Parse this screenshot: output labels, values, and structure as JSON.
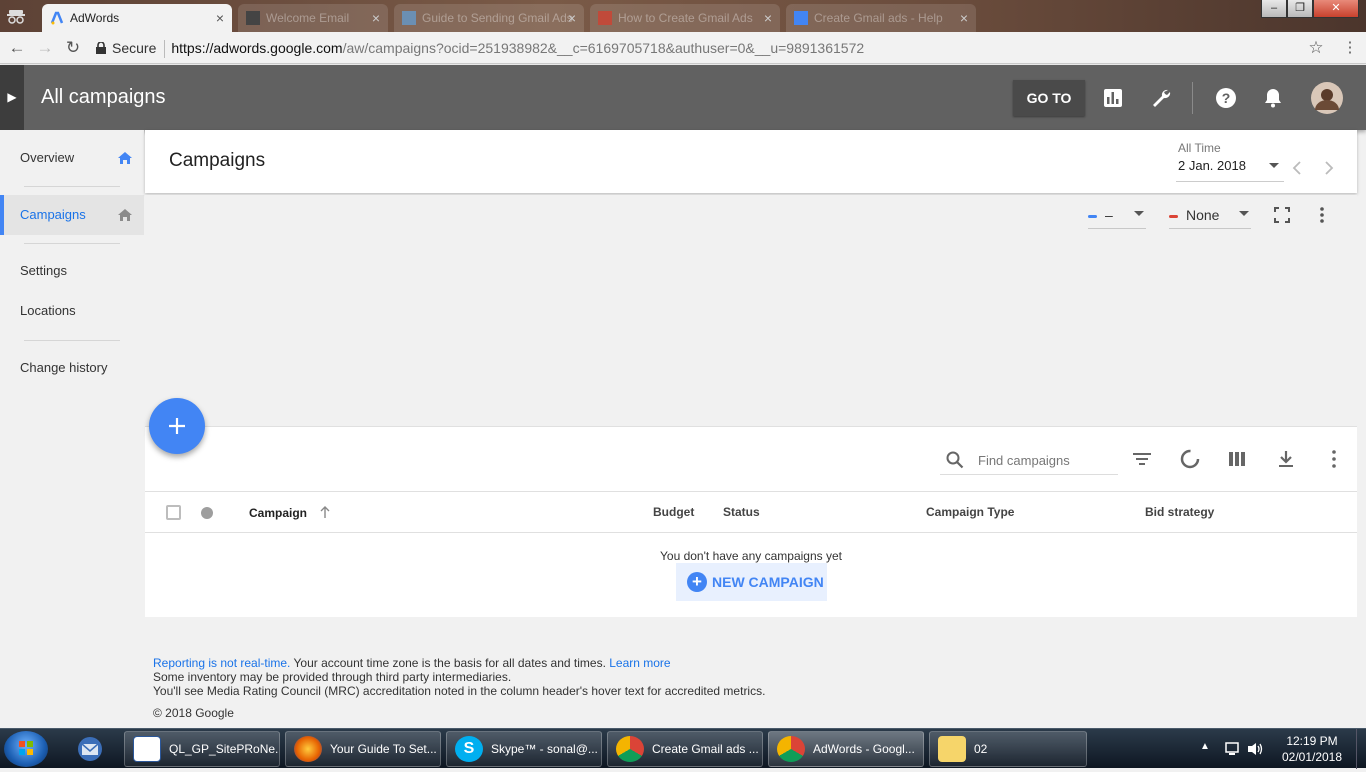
{
  "browser": {
    "tabs": [
      {
        "label": "AdWords",
        "active": true
      },
      {
        "label": "Welcome Email",
        "active": false
      },
      {
        "label": "Guide to Sending Gmail Ads",
        "active": false
      },
      {
        "label": "How to Create Gmail Ads",
        "active": false
      },
      {
        "label": "Create Gmail ads - Help",
        "active": false
      }
    ],
    "close_glyph": "×",
    "secure_label": "Secure",
    "url_host": "https://adwords.google.com",
    "url_path": "/aw/campaigns?ocid=251938982&__c=6169705718&authuser=0&__u=9891361572"
  },
  "app": {
    "title": "All campaigns",
    "goto_label": "GO TO"
  },
  "sidebar": {
    "items": [
      {
        "label": "Overview"
      },
      {
        "label": "Campaigns"
      },
      {
        "label": "Settings"
      },
      {
        "label": "Locations"
      },
      {
        "label": "Change history"
      }
    ]
  },
  "page": {
    "title": "Campaigns",
    "date_range_label": "All Time",
    "date_range_value": "2 Jan. 2018"
  },
  "chart": {
    "metric1": "–",
    "metric2": "None",
    "metric1_color": "#4285f4",
    "metric2_color": "#db4437"
  },
  "table": {
    "search_placeholder": "Find campaigns",
    "columns": [
      "Campaign",
      "Budget",
      "Status",
      "Campaign Type",
      "Bid strategy"
    ],
    "empty_message": "You don't have any campaigns yet",
    "new_campaign_label": "NEW CAMPAIGN"
  },
  "footer": {
    "line1_link": "Reporting is not real-time.",
    "line1_text": " Your account time zone is the basis for all dates and times. ",
    "line1_link2": "Learn more",
    "line2": "Some inventory may be provided through third party intermediaries.",
    "line3": "You'll see Media Rating Council (MRC) accreditation noted in the column header's hover text for accredited metrics.",
    "copyright": "© 2018 Google"
  },
  "taskbar": {
    "buttons": [
      {
        "label": "QL_GP_SitePRoNe..."
      },
      {
        "label": "Your Guide To Set..."
      },
      {
        "label": "Skype™ - sonal@..."
      },
      {
        "label": "Create Gmail ads ..."
      },
      {
        "label": "AdWords - Googl..."
      },
      {
        "label": "02"
      }
    ],
    "time": "12:19 PM",
    "date": "02/01/2018"
  },
  "colors": {
    "brand_blue": "#4285f4",
    "appbar": "#616161"
  }
}
